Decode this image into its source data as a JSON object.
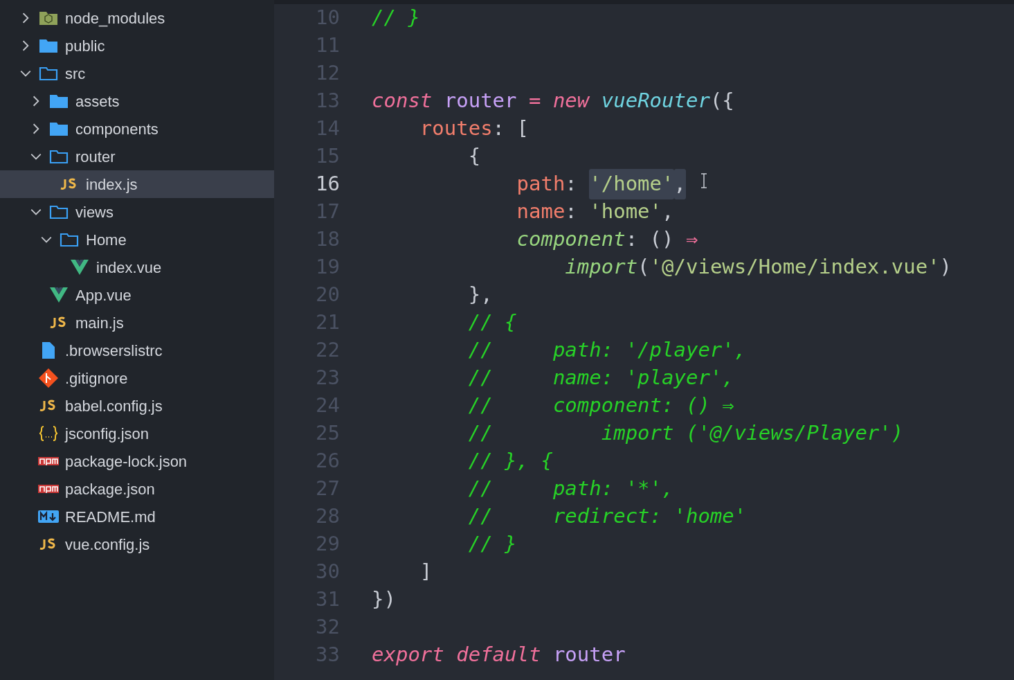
{
  "explorer": {
    "items": [
      {
        "kind": "node",
        "name": "node_modules",
        "expanded": false,
        "selected": false
      },
      {
        "kind": "folder",
        "name": "public",
        "expanded": false,
        "selected": false
      },
      {
        "kind": "folder",
        "name": "src",
        "expanded": true,
        "selected": false,
        "children": [
          {
            "kind": "folder",
            "name": "assets",
            "expanded": false,
            "selected": false
          },
          {
            "kind": "folder",
            "name": "components",
            "expanded": false,
            "selected": false
          },
          {
            "kind": "folder",
            "name": "router",
            "expanded": true,
            "selected": false,
            "children": [
              {
                "kind": "js",
                "name": "index.js",
                "selected": true
              }
            ]
          },
          {
            "kind": "folder",
            "name": "views",
            "expanded": true,
            "selected": false,
            "children": [
              {
                "kind": "folder",
                "name": "Home",
                "expanded": true,
                "selected": false,
                "children": [
                  {
                    "kind": "vue",
                    "name": "index.vue",
                    "selected": false
                  }
                ]
              }
            ]
          },
          {
            "kind": "vue",
            "name": "App.vue",
            "selected": false
          },
          {
            "kind": "js",
            "name": "main.js",
            "selected": false
          }
        ]
      },
      {
        "kind": "file",
        "name": ".browserslistrc",
        "selected": false
      },
      {
        "kind": "git",
        "name": ".gitignore",
        "selected": false
      },
      {
        "kind": "js",
        "name": "babel.config.js",
        "selected": false
      },
      {
        "kind": "json",
        "name": "jsconfig.json",
        "selected": false
      },
      {
        "kind": "npm",
        "name": "package-lock.json",
        "selected": false
      },
      {
        "kind": "npm",
        "name": "package.json",
        "selected": false
      },
      {
        "kind": "md",
        "name": "README.md",
        "selected": false
      },
      {
        "kind": "js",
        "name": "vue.config.js",
        "selected": false
      }
    ]
  },
  "editor": {
    "lines": [
      {
        "number": "10",
        "current": false,
        "cursor": false,
        "tokens": [
          {
            "kind": "cmt",
            "text": "// }"
          }
        ]
      },
      {
        "number": "11",
        "current": false,
        "cursor": false
      },
      {
        "number": "12",
        "current": false,
        "cursor": false
      },
      {
        "number": "13",
        "current": false,
        "cursor": false,
        "tokens": [
          {
            "kind": "kw",
            "text": "const"
          },
          {
            "kind": "var",
            "text": " router"
          },
          {
            "kind": "op",
            "text": " ="
          },
          {
            "kind": "kw",
            "text": " new"
          },
          {
            "kind": "fn",
            "text": " vueRouter"
          },
          {
            "kind": "pun",
            "text": "({"
          }
        ]
      },
      {
        "number": "14",
        "current": false,
        "cursor": false,
        "tokens": [
          {
            "kind": "prop",
            "text": "    routes"
          },
          {
            "kind": "pun",
            "text": ": ["
          }
        ]
      },
      {
        "number": "15",
        "current": false,
        "cursor": false,
        "tokens": [
          {
            "kind": "pun",
            "text": "        {"
          }
        ]
      },
      {
        "number": "16",
        "current": true,
        "cursor": true,
        "tokens": [
          {
            "kind": "prop",
            "text": "            path",
            "selected": false
          },
          {
            "kind": "pun",
            "text": ": ",
            "selected": false
          },
          {
            "kind": "str",
            "text": "'/home'",
            "selected": true
          },
          {
            "kind": "pun",
            "text": ",",
            "selected": true
          }
        ]
      },
      {
        "number": "17",
        "current": false,
        "cursor": false,
        "tokens": [
          {
            "kind": "prop",
            "text": "            name"
          },
          {
            "kind": "pun",
            "text": ": "
          },
          {
            "kind": "str",
            "text": "'home'"
          },
          {
            "kind": "pun",
            "text": ","
          }
        ]
      },
      {
        "number": "18",
        "current": false,
        "cursor": false,
        "tokens": [
          {
            "kind": "meth",
            "text": "            component"
          },
          {
            "kind": "pun",
            "text": ": () "
          },
          {
            "kind": "op",
            "text": "⇒"
          }
        ]
      },
      {
        "number": "19",
        "current": false,
        "cursor": false,
        "tokens": [
          {
            "kind": "meth",
            "text": "                import"
          },
          {
            "kind": "pun",
            "text": "("
          },
          {
            "kind": "str",
            "text": "'@/views/Home/index.vue'"
          },
          {
            "kind": "pun",
            "text": ")"
          }
        ]
      },
      {
        "number": "20",
        "current": false,
        "cursor": false,
        "tokens": [
          {
            "kind": "pun",
            "text": "        },"
          }
        ]
      },
      {
        "number": "21",
        "current": false,
        "cursor": false,
        "tokens": [
          {
            "kind": "cmt",
            "text": "        // {"
          }
        ]
      },
      {
        "number": "22",
        "current": false,
        "cursor": false,
        "tokens": [
          {
            "kind": "cmt",
            "text": "        //     path: '/player',"
          }
        ]
      },
      {
        "number": "23",
        "current": false,
        "cursor": false,
        "tokens": [
          {
            "kind": "cmt",
            "text": "        //     name: 'player',"
          }
        ]
      },
      {
        "number": "24",
        "current": false,
        "cursor": false,
        "tokens": [
          {
            "kind": "cmt",
            "text": "        //     component: () ⇒"
          }
        ]
      },
      {
        "number": "25",
        "current": false,
        "cursor": false,
        "tokens": [
          {
            "kind": "cmt",
            "text": "        //         import ('@/views/Player')"
          }
        ]
      },
      {
        "number": "26",
        "current": false,
        "cursor": false,
        "tokens": [
          {
            "kind": "cmt",
            "text": "        // }, {"
          }
        ]
      },
      {
        "number": "27",
        "current": false,
        "cursor": false,
        "tokens": [
          {
            "kind": "cmt",
            "text": "        //     path: '*',"
          }
        ]
      },
      {
        "number": "28",
        "current": false,
        "cursor": false,
        "tokens": [
          {
            "kind": "cmt",
            "text": "        //     redirect: 'home'"
          }
        ]
      },
      {
        "number": "29",
        "current": false,
        "cursor": false,
        "tokens": [
          {
            "kind": "cmt",
            "text": "        // }"
          }
        ]
      },
      {
        "number": "30",
        "current": false,
        "cursor": false,
        "tokens": [
          {
            "kind": "pun",
            "text": "    ]"
          }
        ]
      },
      {
        "number": "31",
        "current": false,
        "cursor": false,
        "tokens": [
          {
            "kind": "pun",
            "text": "})"
          }
        ]
      },
      {
        "number": "32",
        "current": false,
        "cursor": false
      },
      {
        "number": "33",
        "current": false,
        "cursor": false,
        "tokens": [
          {
            "kind": "kw",
            "text": "export default"
          },
          {
            "kind": "var",
            "text": " router"
          }
        ]
      }
    ]
  }
}
